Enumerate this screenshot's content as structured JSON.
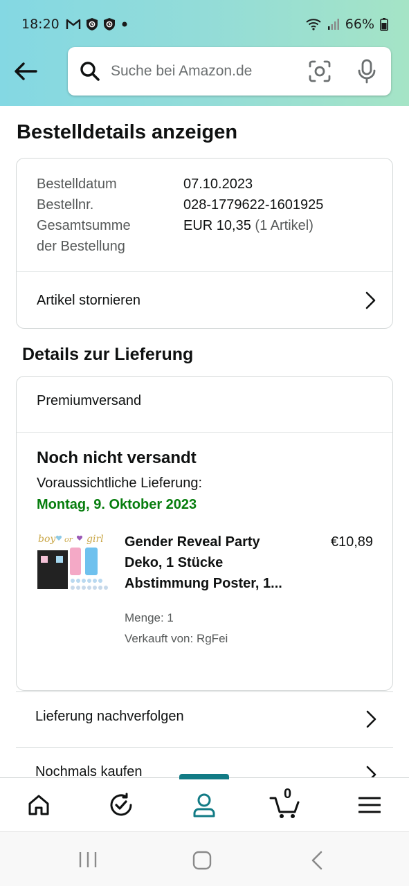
{
  "status_bar": {
    "time": "18:20",
    "battery": "66%",
    "icons": [
      "gmail-icon",
      "shield-app-icon",
      "shield-app-icon",
      "dot-icon",
      "wifi-icon",
      "signal-icon",
      "battery-icon"
    ]
  },
  "search": {
    "placeholder": "Suche bei Amazon.de"
  },
  "page": {
    "title": "Bestelldetails anzeigen"
  },
  "order": {
    "date_label": "Bestelldatum",
    "date_value": "07.10.2023",
    "number_label": "Bestellnr.",
    "number_value": "028-1779622-1601925",
    "total_label_line1": "Gesamtsumme",
    "total_label_line2": "der Bestellung",
    "total_value": "EUR 10,35",
    "total_items": "(1 Artikel)",
    "cancel_label": "Artikel stornieren"
  },
  "delivery": {
    "section_title": "Details zur Lieferung",
    "shipping_type": "Premiumversand",
    "status": "Noch nicht versandt",
    "eta_label": "Voraussichtliche Lieferung:",
    "eta_date": "Montag, 9. Oktober 2023",
    "item": {
      "title": "Gender Reveal Party Deko, 1 Stücke Abstimmung Poster, 1...",
      "price": "€10,89",
      "quantity": "Menge: 1",
      "seller": "Verkauft von: RgFei",
      "thumb_text_1": "boy",
      "thumb_text_2": "or",
      "thumb_text_3": "girl"
    }
  },
  "actions": {
    "track": "Lieferung nachverfolgen",
    "buy_again": "Nochmals kaufen"
  },
  "bottom_nav": {
    "cart_count": "0",
    "active": "account"
  },
  "colors": {
    "header_start": "#84d8e3",
    "header_end": "#a5e4c6",
    "delivery_green": "#067d0d",
    "nav_teal": "#127b85"
  }
}
